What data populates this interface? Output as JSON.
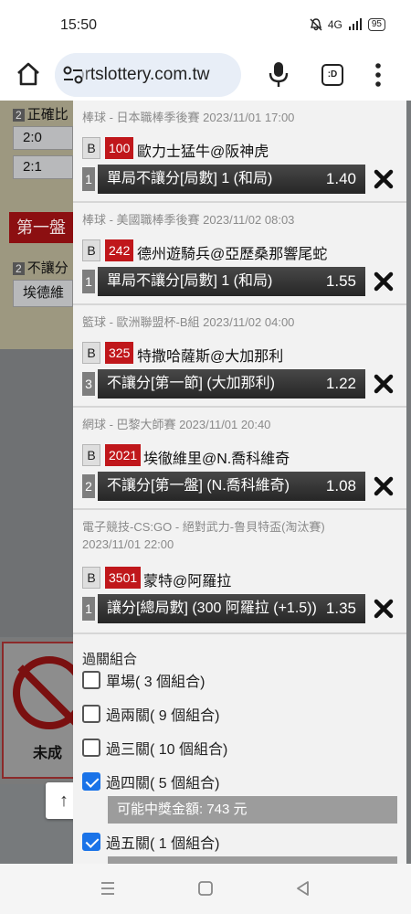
{
  "status_bar": {
    "time": "15:50",
    "network": "4G",
    "battery": "95"
  },
  "browser": {
    "url": "ortslottery.com.tw",
    "tab_count": ":D"
  },
  "background": {
    "header_1": "正確比",
    "header_1_num": "2",
    "score_1": "2:0",
    "score_2": "2:1",
    "red_title": "第一盤",
    "header_2": "不讓分",
    "header_2_num": "2",
    "team_row": "埃德維",
    "poster_text": "未成"
  },
  "slip": {
    "bets": [
      {
        "league": "棒球 - 日本職棒季後賽 2023/11/01 17:00",
        "tag": "B",
        "game_no": "100",
        "teams": "歐力士猛牛@阪神虎",
        "line_no": "1",
        "market": "單局不讓分[局數] 1 (和局)",
        "odds": "1.40"
      },
      {
        "league": "棒球 - 美國職棒季後賽 2023/11/02 08:03",
        "tag": "B",
        "game_no": "242",
        "teams": "德州遊騎兵@亞歷桑那響尾蛇",
        "line_no": "1",
        "market": "單局不讓分[局數] 1 (和局)",
        "odds": "1.55"
      },
      {
        "league": "籃球 - 歐洲聯盟杯-B組 2023/11/02 04:00",
        "tag": "B",
        "game_no": "325",
        "teams": "特撒哈薩斯@大加那利",
        "line_no": "3",
        "market": "不讓分[第一節] (大加那利)",
        "odds": "1.22"
      },
      {
        "league": "網球 - 巴黎大師賽 2023/11/01 20:40",
        "tag": "B",
        "game_no": "2021",
        "teams": "埃徹維里@N.喬科維奇",
        "line_no": "2",
        "market": "不讓分[第一盤] (N.喬科維奇)",
        "odds": "1.08"
      },
      {
        "league": "電子競技-CS:GO - 絕對武力-鲁貝特盃(淘汰賽)",
        "league_date": "2023/11/01 22:00",
        "tag": "B",
        "game_no": "3501",
        "teams": "蒙特@阿羅拉",
        "line_no": "1",
        "market": "讓分[總局數] (300 阿羅拉 (+1.5))",
        "odds": "1.35"
      }
    ],
    "parlay": {
      "title": "過關組合",
      "options": [
        {
          "label": "單場( 3 個組合)",
          "checked": false
        },
        {
          "label": "過兩關( 9 個組合)",
          "checked": false
        },
        {
          "label": "過三關( 10 個組合)",
          "checked": false
        },
        {
          "label": "過四關( 5 個組合)",
          "checked": true,
          "prize": "可能中獎金額: 743 元"
        },
        {
          "label": "過五關( 1 個組合)",
          "checked": true
        }
      ]
    }
  },
  "colors": {
    "game_no_bg": "#c0171b",
    "checkbox": "#1a73e8",
    "market_bar": "#333333",
    "prize_bar": "#9c9c9c"
  }
}
